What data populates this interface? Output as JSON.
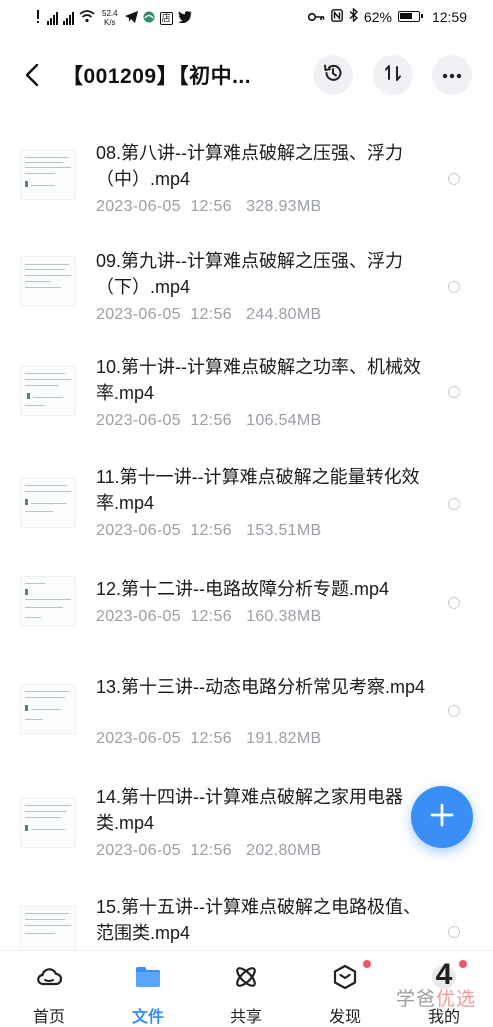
{
  "status_bar": {
    "speed_value": "52.4",
    "speed_unit": "K/s",
    "store_label": "店",
    "battery": "62%",
    "time": "12:59"
  },
  "header": {
    "title": "【001209】【初中...",
    "icons": [
      "back-icon",
      "history-icon",
      "sort-icon",
      "more-icon"
    ]
  },
  "files": [
    {
      "name": "08.第八讲--计算难点破解之压强、浮力（中）.mp4",
      "date": "2023-06-05  12:56",
      "size": "328.93MB"
    },
    {
      "name": "09.第九讲--计算难点破解之压强、浮力（下）.mp4",
      "date": "2023-06-05  12:56",
      "size": "244.80MB"
    },
    {
      "name": "10.第十讲--计算难点破解之功率、机械效率.mp4",
      "date": "2023-06-05  12:56",
      "size": "106.54MB"
    },
    {
      "name": "11.第十一讲--计算难点破解之能量转化效率.mp4",
      "date": "2023-06-05  12:56",
      "size": "153.51MB"
    },
    {
      "name": "12.第十二讲--电路故障分析专题.mp4",
      "date": "2023-06-05  12:56",
      "size": "160.38MB"
    },
    {
      "name": "13.第十三讲--动态电路分析常见考察.mp4",
      "date": "2023-06-05  12:56",
      "size": "191.82MB"
    },
    {
      "name": "14.第十四讲--计算难点破解之家用电器类.mp4",
      "date": "2023-06-05  12:56",
      "size": "202.80MB"
    },
    {
      "name": "15.第十五讲--计算难点破解之电路极值、范围类.mp4",
      "date": "",
      "size": ""
    }
  ],
  "bottom_nav": [
    {
      "label": "首页",
      "icon": "cloud-icon",
      "active": false
    },
    {
      "label": "文件",
      "icon": "folder-icon",
      "active": true
    },
    {
      "label": "共享",
      "icon": "share-icon",
      "active": false
    },
    {
      "label": "发现",
      "icon": "discover-icon",
      "active": false
    },
    {
      "label": "我的",
      "icon": "profile-icon",
      "active": false
    }
  ],
  "watermark": {
    "text_a": "学爸",
    "text_b": "优选",
    "number": "4"
  },
  "colors": {
    "accent": "#3a8ef6",
    "meta_text": "#9a9fa6",
    "badge_red": "#f0566a"
  }
}
